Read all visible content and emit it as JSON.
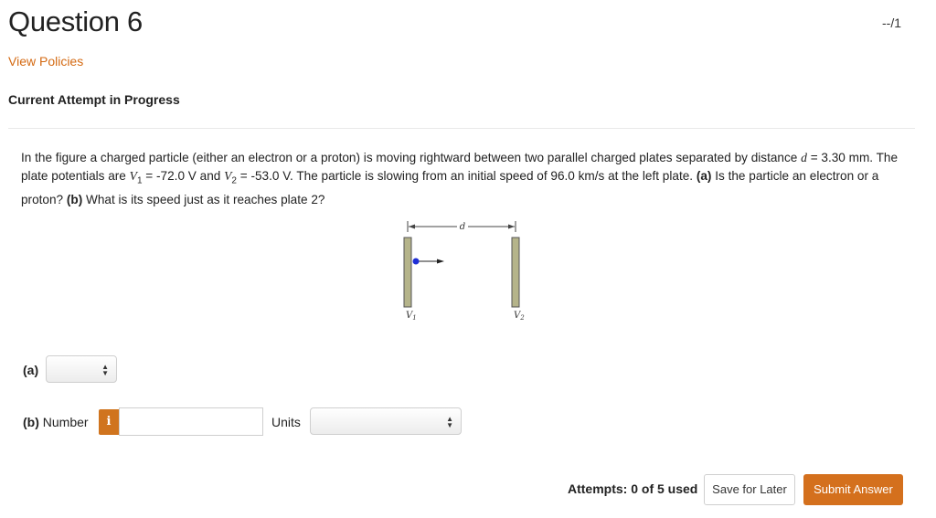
{
  "header": {
    "title": "Question 6",
    "score": "--/1",
    "policies_link": "View Policies",
    "attempt_status": "Current Attempt in Progress"
  },
  "question": {
    "t1": "In the figure a charged particle (either an electron or a proton) is moving rightward between two parallel charged plates separated by distance ",
    "d_sym": "d",
    "t2": " = 3.30 mm. The plate potentials are ",
    "v_sym": "V",
    "sub1": "1",
    "t3": " = -72.0 V and ",
    "sub2": "2",
    "t4": " = -53.0 V. The particle is slowing from an initial speed of 96.0 km/s at the left plate. ",
    "a_tag": "(a)",
    "t5": " Is the particle an electron or a proton? ",
    "b_tag": "(b)",
    "t6": " What is its speed just as it reaches plate 2?"
  },
  "figure": {
    "distance_label": "d",
    "plate1_label": "V",
    "plate1_sub": "1",
    "plate2_label": "V",
    "plate2_sub": "2",
    "plate_color": "#b5b48a",
    "particle_color": "#1f2fd6"
  },
  "part_a": {
    "label": "(a)",
    "selected": ""
  },
  "part_b": {
    "label_prefix": "(b)",
    "label_text": " Number",
    "info_icon": "i",
    "number_value": "",
    "units_label": "Units",
    "units_selected": ""
  },
  "footer": {
    "attempts": "Attempts: 0 of 5 used",
    "save_label": "Save for Later",
    "submit_label": "Submit Answer"
  },
  "colors": {
    "accent": "#d4701d",
    "link": "#d46a13"
  }
}
